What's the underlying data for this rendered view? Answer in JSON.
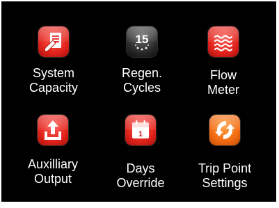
{
  "menu": {
    "items": [
      {
        "label": "System\nCapacity",
        "icon": "document-pencil-icon",
        "color": "red"
      },
      {
        "label": "Regen.\nCycles",
        "icon": "calendar-15-icon",
        "color": "dark",
        "icon_text": "15"
      },
      {
        "label": "Flow\nMeter",
        "icon": "water-waves-icon",
        "color": "red"
      },
      {
        "label": "Auxilliary\nOutput",
        "icon": "upload-icon",
        "color": "red"
      },
      {
        "label": "Days\nOverride",
        "icon": "calendar-1-icon",
        "color": "red",
        "icon_text": "1"
      },
      {
        "label": "Trip Point\nSettings",
        "icon": "sync-arrows-icon",
        "color": "orange"
      }
    ]
  }
}
